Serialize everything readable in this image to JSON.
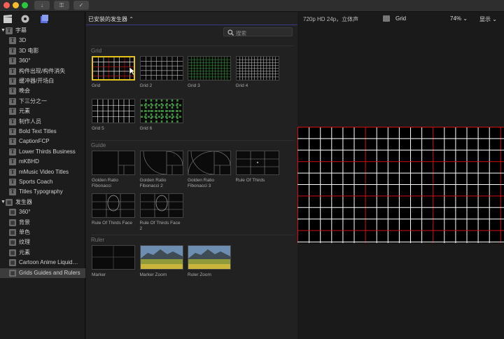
{
  "toolbar": {
    "buttons": [
      {
        "icon": "download-icon",
        "glyph": "↓"
      },
      {
        "icon": "key-icon",
        "glyph": "⚿"
      },
      {
        "icon": "checkmark-icon",
        "glyph": "✓"
      }
    ]
  },
  "sidebar": {
    "tools": [
      "clapper-icon",
      "photos-music-icon",
      "titles-generators-icon"
    ],
    "titles_label": "字幕",
    "title_items": [
      "3D",
      "3D 电影",
      "360°",
      "构件出现/构件消失",
      "缓冲器/开场白",
      "晚会",
      "下三分之一",
      "元素",
      "制作人员",
      "Bold Text Titles",
      "CaptionFCP",
      "Lower Thirds Business",
      "mKBHD",
      "mMusic Video Titles",
      "Sports Coach",
      "Titles Typography"
    ],
    "generators_label": "发生器",
    "generator_items": [
      "360°",
      "背景",
      "单色",
      "纹理",
      "元素",
      "Cartoon Anime Liquid…",
      "Grids Guides and Rulers"
    ]
  },
  "browser": {
    "header": "已安装的发生器 ⌃",
    "search_placeholder": "搜索",
    "sections": [
      {
        "name": "Grid",
        "items": [
          "Grid",
          "Grid 2",
          "Grid 3",
          "Grid 4",
          "Grid 5",
          "Grid 6"
        ]
      },
      {
        "name": "Guide",
        "items": [
          "Golden Ratio Fibonacci",
          "Golden Ratio Fibonacci 2",
          "Golden Ratio Fibonacci 3",
          "Rule Of Thirds",
          "Rule Of Thirds Face",
          "Rule Of Thirds Face 2"
        ]
      },
      {
        "name": "Ruler",
        "items": [
          "Marker",
          "Marker Zoom",
          "Ruler Zoom"
        ]
      }
    ]
  },
  "viewer": {
    "format": "720p HD 24p，立体声",
    "clip_name": "Grid",
    "zoom": "74% ⌄",
    "display_menu": "显示 ⌄"
  },
  "colors": {
    "selection": "#e3c319",
    "grid_red": "#d01010",
    "grid_white": "#ffffff"
  }
}
